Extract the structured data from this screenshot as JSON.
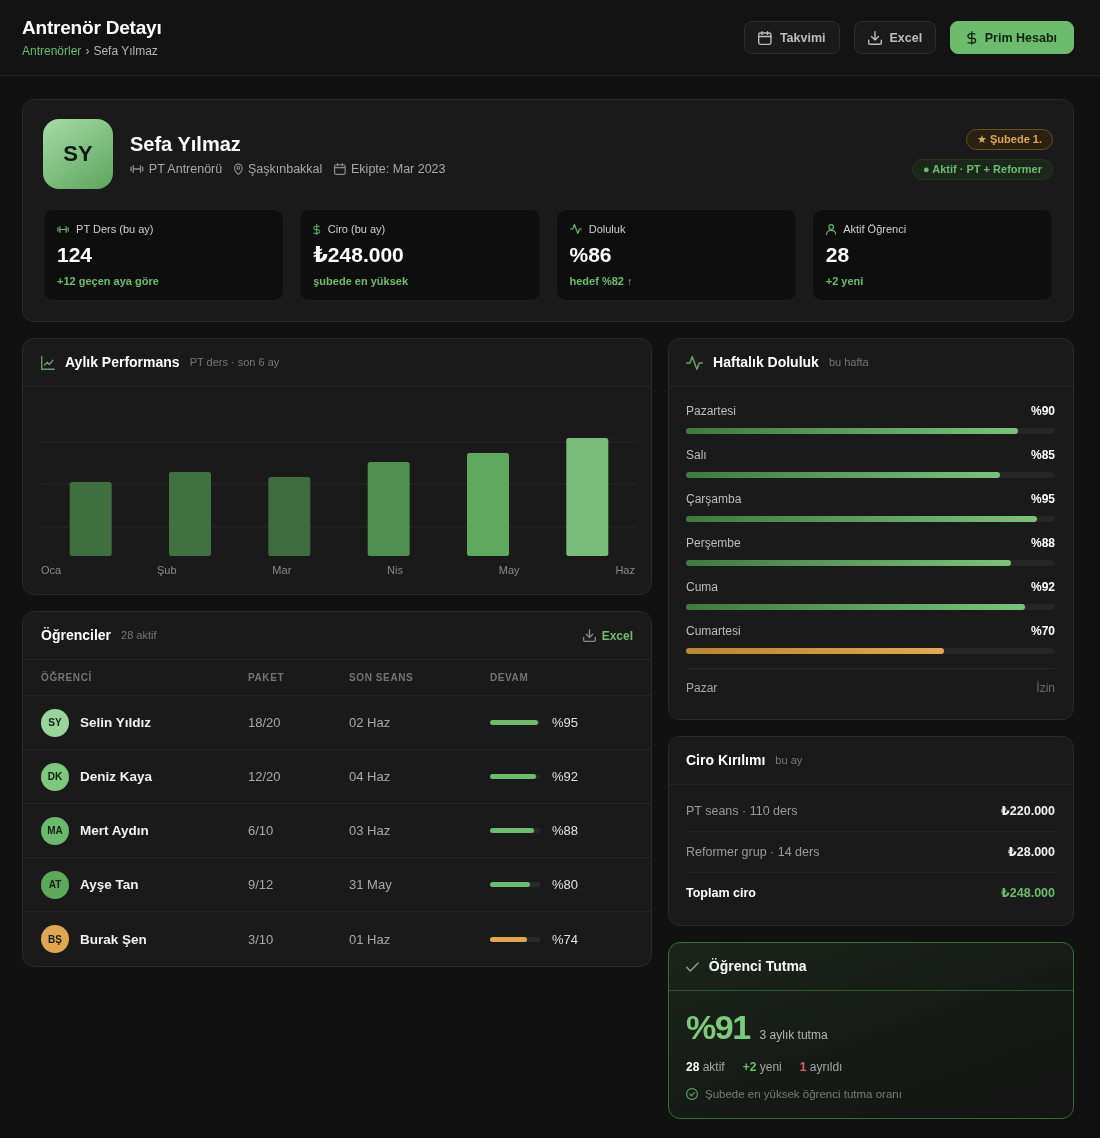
{
  "header": {
    "title": "Antrenör Detayı",
    "breadcrumb": {
      "parent": "Antrenörler",
      "separator": "›",
      "current": "Sefa Yılmaz"
    },
    "buttons": [
      {
        "kind": "calendar",
        "label": "Takvimi",
        "primary": false
      },
      {
        "kind": "download",
        "label": "Excel",
        "primary": false
      },
      {
        "kind": "money",
        "label": "Prim Hesabı",
        "primary": true
      }
    ]
  },
  "profile": {
    "initials": "SY",
    "name": "Sefa Yılmaz",
    "meta": [
      {
        "kind": "role",
        "text": "PT Antrenörü"
      },
      {
        "kind": "location",
        "text": "Şaşkınbakkal"
      },
      {
        "kind": "joined",
        "text": "Ekipte: Mar 2023"
      }
    ],
    "badges": [
      {
        "kind": "rank",
        "text": "★ Şubede 1."
      },
      {
        "kind": "status",
        "text": "● Aktif · PT + Reformer"
      }
    ],
    "stats": [
      {
        "kind": "sessions",
        "label": "PT Ders (bu ay)",
        "value": "124",
        "note": "+12 geçen aya göre"
      },
      {
        "kind": "revenue",
        "label": "Ciro (bu ay)",
        "value": "₺248.000",
        "note": "şubede en yüksek"
      },
      {
        "kind": "occupancy",
        "label": "Doluluk",
        "value": "%86",
        "note": "hedef %82 ↑"
      },
      {
        "kind": "students",
        "label": "Aktif Öğrenci",
        "value": "28",
        "note": "+2 yeni"
      }
    ]
  },
  "performance": {
    "title": "Aylık Performans",
    "subtitle": "PT ders · son 6 ay",
    "months": [
      "Oca",
      "Şub",
      "Mar",
      "Nis",
      "May",
      "Haz"
    ]
  },
  "students": {
    "title": "Öğrenciler",
    "count": "28 aktif",
    "export": "Excel",
    "columns": [
      "ÖĞRENCİ",
      "PAKET",
      "SON SEANS",
      "DEVAM"
    ],
    "rows": [
      {
        "initials": "SY",
        "name": "Selin Yıldız",
        "color": "#9ad49a",
        "package": "18/20",
        "last_session": "02 Haz",
        "level": 0.95,
        "attendance": "%95"
      },
      {
        "initials": "DK",
        "name": "Deniz Kaya",
        "color": "#7fc67f",
        "package": "12/20",
        "last_session": "04 Haz",
        "level": 0.92,
        "attendance": "%92"
      },
      {
        "initials": "MA",
        "name": "Mert Aydın",
        "color": "#6cb86c",
        "package": "6/10",
        "last_session": "03 Haz",
        "level": 0.88,
        "attendance": "%88"
      },
      {
        "initials": "AT",
        "name": "Ayşe Tan",
        "color": "#5ea85e",
        "package": "9/12",
        "last_session": "31 May",
        "level": 0.8,
        "attendance": "%80"
      },
      {
        "initials": "BŞ",
        "name": "Burak Şen",
        "color": "#e0a84e",
        "package": "3/10",
        "last_session": "01 Haz",
        "level": 0.74,
        "attendance": "%74"
      }
    ]
  },
  "weekly": {
    "title": "Haftalık Doluluk",
    "subtitle": "bu hafta",
    "days": [
      {
        "kind": "bar",
        "day": "Pazartesi",
        "level": 0.9,
        "reading": "%90"
      },
      {
        "kind": "bar",
        "day": "Salı",
        "level": 0.85,
        "reading": "%85"
      },
      {
        "kind": "bar",
        "day": "Çarşamba",
        "level": 0.95,
        "reading": "%95"
      },
      {
        "kind": "bar",
        "day": "Perşembe",
        "level": 0.88,
        "reading": "%88"
      },
      {
        "kind": "bar",
        "day": "Cuma",
        "level": 0.92,
        "reading": "%92"
      },
      {
        "kind": "bar",
        "day": "Cumartesi",
        "level": 0.7,
        "reading": "%70"
      },
      {
        "kind": "off",
        "day": "Pazar",
        "note": "İzin"
      }
    ]
  },
  "revenue": {
    "title": "Ciro Kırılımı",
    "subtitle": "bu ay",
    "rows": [
      {
        "kind": "item",
        "label": "PT seans · 110 ders",
        "amount": "₺220.000"
      },
      {
        "kind": "item",
        "label": "Reformer grup · 14 ders",
        "amount": "₺28.000"
      },
      {
        "kind": "total",
        "label": "Toplam ciro",
        "amount": "₺248.000"
      }
    ]
  },
  "retention": {
    "title": "Öğrenci Tutma",
    "value": "%91",
    "caption": "3 aylık tutma",
    "stats": [
      {
        "kind": "neutral",
        "text": "**28** aktif"
      },
      {
        "kind": "positive",
        "text": "**+2** yeni"
      },
      {
        "kind": "negative",
        "text": "**1** ayrıldı"
      }
    ],
    "note": "Şubede en yüksek öğrenci tutma oranı"
  }
}
